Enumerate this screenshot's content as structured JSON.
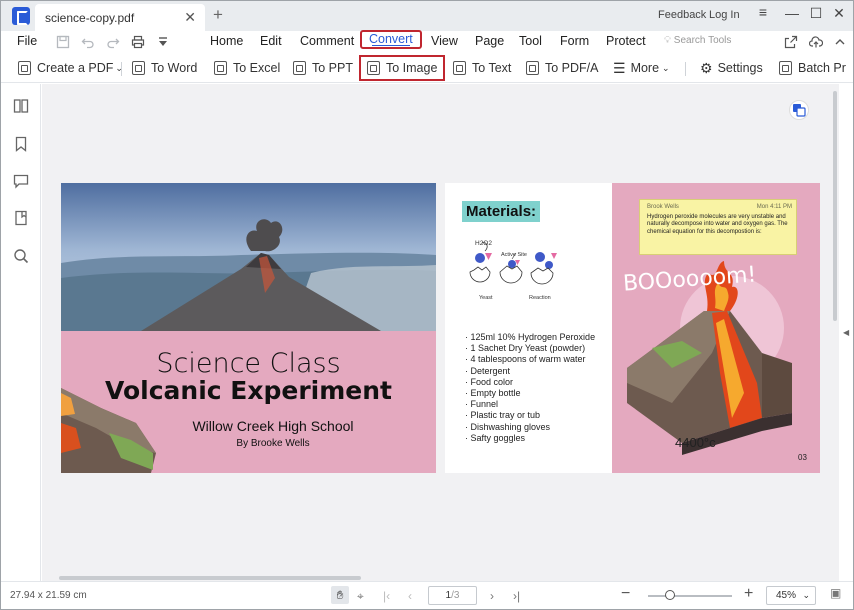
{
  "titlebar": {
    "tab_label": "science-copy.pdf",
    "feedback": "Feedback",
    "login": "Log In"
  },
  "menubar": {
    "file": "File",
    "items": [
      "Home",
      "Edit",
      "Comment",
      "Convert",
      "View",
      "Page",
      "Tool",
      "Form",
      "Protect"
    ],
    "search_placeholder": "Search Tools"
  },
  "toolbar": {
    "create_pdf": "Create a PDF",
    "to_word": "To Word",
    "to_excel": "To Excel",
    "to_ppt": "To PPT",
    "to_image": "To Image",
    "to_text": "To Text",
    "to_pdfa": "To PDF/A",
    "more": "More",
    "settings": "Settings",
    "batch": "Batch Pr"
  },
  "document": {
    "left_page": {
      "title_line1": "Science Class",
      "title_line2": "Volcanic Experiment",
      "school": "Willow Creek High School",
      "byline": "By Brooke Wells"
    },
    "right_page": {
      "materials_heading": "Materials:",
      "diagram_labels": [
        "H2O2",
        "Active Site",
        "Yeast",
        "Reaction"
      ],
      "materials": [
        "125ml 10% Hydrogen Peroxide",
        "1 Sachet Dry Yeast (powder)",
        "4 tablespoons of warm water",
        "Detergent",
        "Food color",
        "Empty bottle",
        "Funnel",
        "Plastic tray or tub",
        "Dishwashing gloves",
        "Safty goggles"
      ],
      "note": {
        "author": "Brook Wells",
        "time": "Mon 4:11 PM",
        "body": "Hydrogen peroxide molecules are very unstable and naturally decompose into water and oxygen gas. The chemical equation for this decompostion is:"
      },
      "boom": "BOOoooom!",
      "temperature": "4400°c",
      "page_number": "03"
    }
  },
  "statusbar": {
    "dimensions": "27.94 x 21.59 cm",
    "current_page": "1",
    "total_pages": "/3",
    "zoom": "45%"
  }
}
